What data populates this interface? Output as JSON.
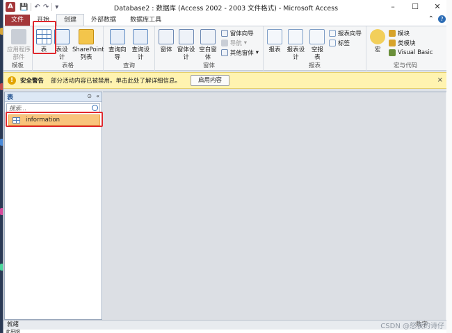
{
  "window": {
    "title": "Database2 : 数据库 (Access 2002 - 2003 文件格式) - Microsoft Access",
    "app_icon": "A",
    "controls": {
      "minimize": "–",
      "maximize": "☐",
      "close": "✕"
    }
  },
  "qat": {
    "save": "💾",
    "undo": "↶",
    "redo": "↷",
    "customize": "▾"
  },
  "tabs": [
    {
      "label": "文件"
    },
    {
      "label": "开始"
    },
    {
      "label": "创建"
    },
    {
      "label": "外部数据"
    },
    {
      "label": "数据库工具"
    }
  ],
  "ribbon": {
    "groups": [
      {
        "label": "模板",
        "buttons": [
          "应用程序部件"
        ]
      },
      {
        "label": "表格",
        "buttons": [
          "表",
          "表设计",
          "SharePoint 列表"
        ]
      },
      {
        "label": "查询",
        "buttons": [
          "查询向导",
          "查询设计"
        ]
      },
      {
        "label": "窗体",
        "buttons": [
          "窗体",
          "窗体设计",
          "空白窗体"
        ],
        "small": [
          "窗体向导",
          "导航",
          "其他窗体"
        ]
      },
      {
        "label": "报表",
        "buttons": [
          "报表",
          "报表设计",
          "空报表"
        ],
        "small": [
          "报表向导",
          "标签"
        ]
      },
      {
        "label": "宏与代码",
        "buttons": [
          "宏"
        ],
        "small": [
          "模块",
          "类模块",
          "Visual Basic"
        ]
      }
    ]
  },
  "security_bar": {
    "title": "安全警告",
    "message": "部分活动内容已被禁用。单击此处了解详细信息。",
    "button": "启用内容",
    "close": "×",
    "icon": "!"
  },
  "nav_pane": {
    "header": "表",
    "search_placeholder": "搜索...",
    "items": [
      {
        "label": "information"
      }
    ]
  },
  "status": {
    "left": "就绪",
    "right": "数字"
  },
  "watermark": "CSDN @怒夜的诗仔",
  "bottom_text": "此电脑"
}
